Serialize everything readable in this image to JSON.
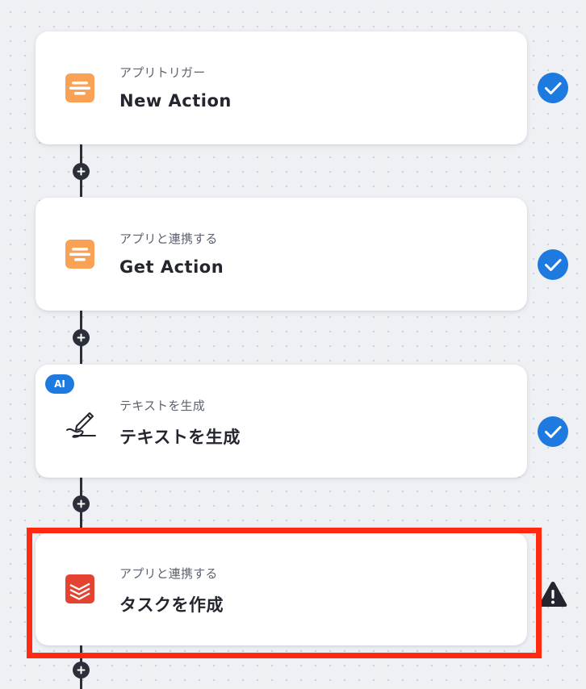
{
  "flow": {
    "steps": [
      {
        "subtitle": "アプリトリガー",
        "title": "New Action",
        "icon": "form-app-icon",
        "status": "complete"
      },
      {
        "subtitle": "アプリと連携する",
        "title": "Get Action",
        "icon": "form-app-icon",
        "status": "complete"
      },
      {
        "subtitle": "テキストを生成",
        "title": "テキストを生成",
        "icon": "pen-write-icon",
        "badge": "AI",
        "status": "complete"
      },
      {
        "subtitle": "アプリと連携する",
        "title": "タスクを作成",
        "icon": "todoist-icon",
        "status": "warning",
        "highlighted": true
      }
    ]
  },
  "colors": {
    "accent": "#1f7ae0",
    "connector": "#2b2f3a",
    "highlight": "#ff2a10",
    "form_icon": "#f9a255",
    "todoist_icon": "#e44332",
    "warning": "#23262e"
  }
}
